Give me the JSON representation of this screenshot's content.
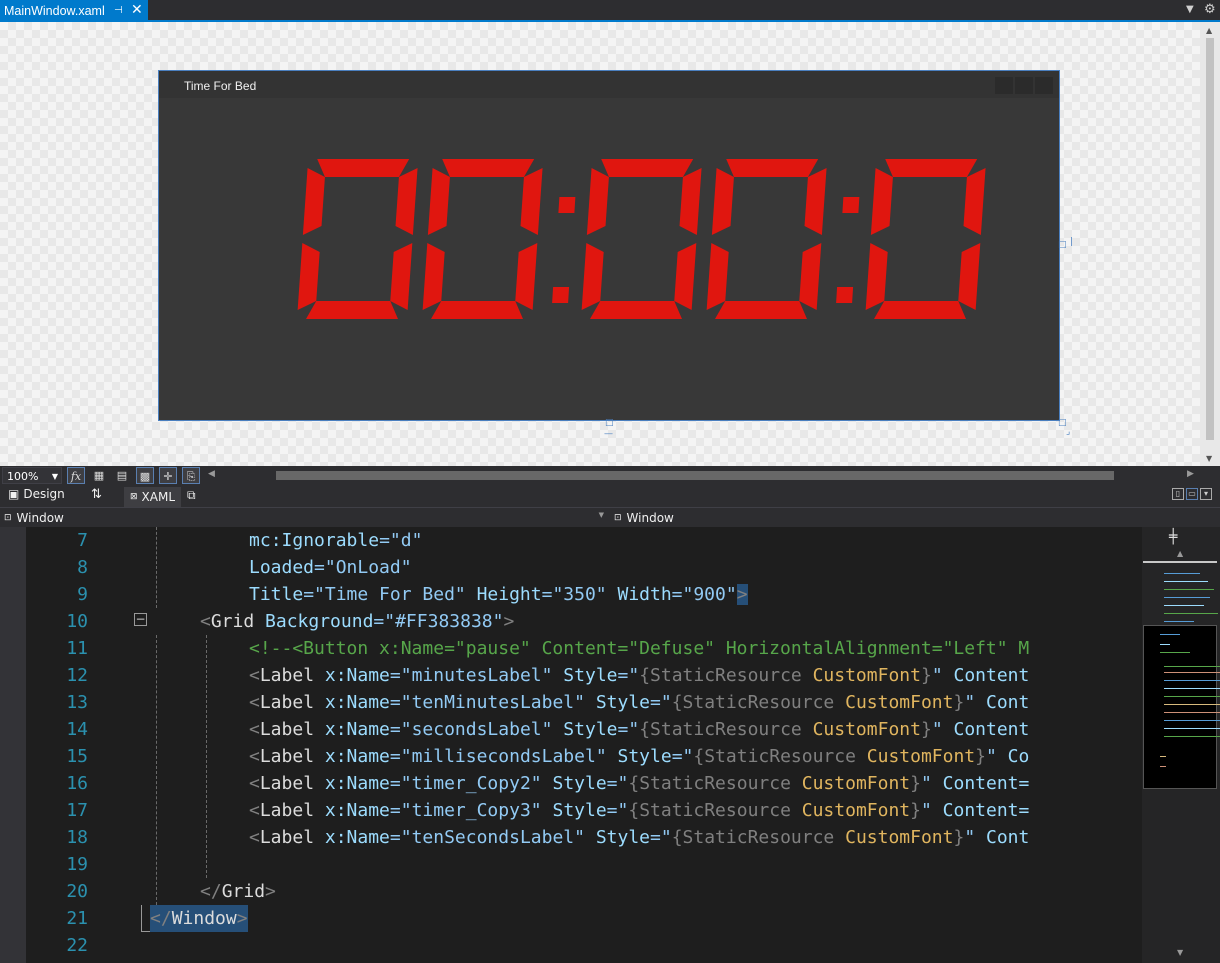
{
  "tab": {
    "title": "MainWindow.xaml"
  },
  "designer": {
    "window_title": "Time For Bed",
    "display_text": "00:00:0",
    "display_color": "#e0160f",
    "background": "#383838"
  },
  "toolbar": {
    "zoom": "100%"
  },
  "split": {
    "design_label": "Design",
    "xaml_label": "XAML"
  },
  "nav": {
    "left": "Window",
    "right": "Window"
  },
  "code": {
    "lines": [
      {
        "n": "7"
      },
      {
        "n": "8"
      },
      {
        "n": "9"
      },
      {
        "n": "10"
      },
      {
        "n": "11"
      },
      {
        "n": "12"
      },
      {
        "n": "13"
      },
      {
        "n": "14"
      },
      {
        "n": "15"
      },
      {
        "n": "16"
      },
      {
        "n": "17"
      },
      {
        "n": "18"
      },
      {
        "n": "19"
      },
      {
        "n": "20"
      },
      {
        "n": "21"
      },
      {
        "n": "22"
      }
    ],
    "t": {
      "l7a": "mc",
      "l7b": ":Ignorable",
      "l7c": "=\"d\"",
      "l8a": "Loaded",
      "l8b": "=\"OnLoad\"",
      "l9a": "Title",
      "l9b": "=\"Time For Bed\"",
      "l9c": " Height",
      "l9d": "=\"350\"",
      "l9e": " Width",
      "l9f": "=\"900\"",
      "l9g": ">",
      "l10a": "<",
      "l10b": "Grid",
      "l10c": " Background",
      "l10d": "=\"#FF383838\"",
      "l10e": ">",
      "l11": "<!--<Button x:Name=\"pause\" Content=\"Defuse\" HorizontalAlignment=\"Left\" M",
      "label_open": "<",
      "label_tag": "Label",
      "xname": " x:Name",
      "eq": "=\"",
      "style": " Style",
      "q": "\"",
      "sr_open": "{",
      "sr": "StaticResource",
      "cf": " CustomFont",
      "sr_close": "}",
      "l12n": "minutesLabel",
      "l12t": " Content",
      "l13n": "tenMinutesLabel",
      "l13t": " Cont",
      "l14n": "secondsLabel",
      "l14t": " Content",
      "l15n": "millisecondsLabel",
      "l15t": " Co",
      "l16n": "timer_Copy2",
      "l16t": " Content=",
      "l17n": "timer_Copy3",
      "l17t": " Content=",
      "l18n": "tenSecondsLabel",
      "l18t": " Cont",
      "l20a": "</",
      "l20b": "Grid",
      "l20c": ">",
      "l21a": "</",
      "l21b": "Window",
      "l21c": ">"
    }
  }
}
